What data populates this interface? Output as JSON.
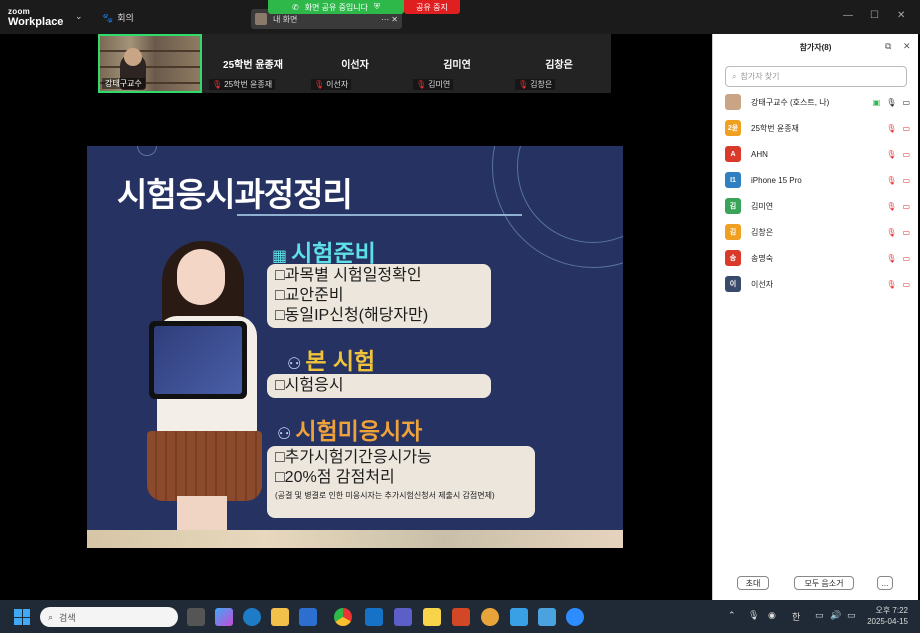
{
  "app": {
    "brand_line1": "zoom",
    "brand_line2": "Workplace",
    "meeting_label": "회의"
  },
  "share": {
    "status": "화면 공유 중입니다",
    "stop_label": "공유 중지",
    "my_screen": "내 화면"
  },
  "gallery": {
    "self_name": "강태구교수",
    "tiles": [
      {
        "name": "25학번 윤종재",
        "tag": "25학번 윤종재"
      },
      {
        "name": "이선자",
        "tag": "이선자"
      },
      {
        "name": "김미연",
        "tag": "김미연"
      },
      {
        "name": "김창은",
        "tag": "김창은"
      }
    ]
  },
  "slide": {
    "title": "시험응시과정정리",
    "sections": [
      {
        "heading": "시험준비",
        "items": [
          "□과목별 시험일정확인",
          "□교안준비",
          "□동일IP신청(해당자만)"
        ]
      },
      {
        "heading": "본 시험",
        "items": [
          "□시험응시"
        ]
      },
      {
        "heading": "시험미응시자",
        "items": [
          "□추가시험기간응시가능",
          "□20%점 감점처리"
        ],
        "note": "(공결 및 병결로 인한 미응시자는 추가시험신청서 제출시 감점면제)"
      }
    ]
  },
  "panel": {
    "title": "참가자(8)",
    "search_placeholder": "참가자 찾기",
    "participants": [
      {
        "initial": "",
        "name": "강태구교수 (호스트, 나)",
        "color": "#ffffff"
      },
      {
        "initial": "2윤",
        "name": "25학번 윤종재",
        "color": "#f0a020"
      },
      {
        "initial": "A",
        "name": "AHN",
        "color": "#d93a2b"
      },
      {
        "initial": "I1",
        "name": "iPhone 15 Pro",
        "color": "#2f7fc1"
      },
      {
        "initial": "김",
        "name": "김미연",
        "color": "#3aa35a"
      },
      {
        "initial": "김",
        "name": "김창은",
        "color": "#f0a020"
      },
      {
        "initial": "송",
        "name": "송명숙",
        "color": "#d93a2b"
      },
      {
        "initial": "이",
        "name": "이선자",
        "color": "#3a4a6a"
      }
    ],
    "invite_label": "초대",
    "mute_all_label": "모두 음소거",
    "more_label": "..."
  },
  "taskbar": {
    "search_placeholder": "검색",
    "time": "오후 7:22",
    "date": "2025-04-15",
    "ime": "한"
  }
}
